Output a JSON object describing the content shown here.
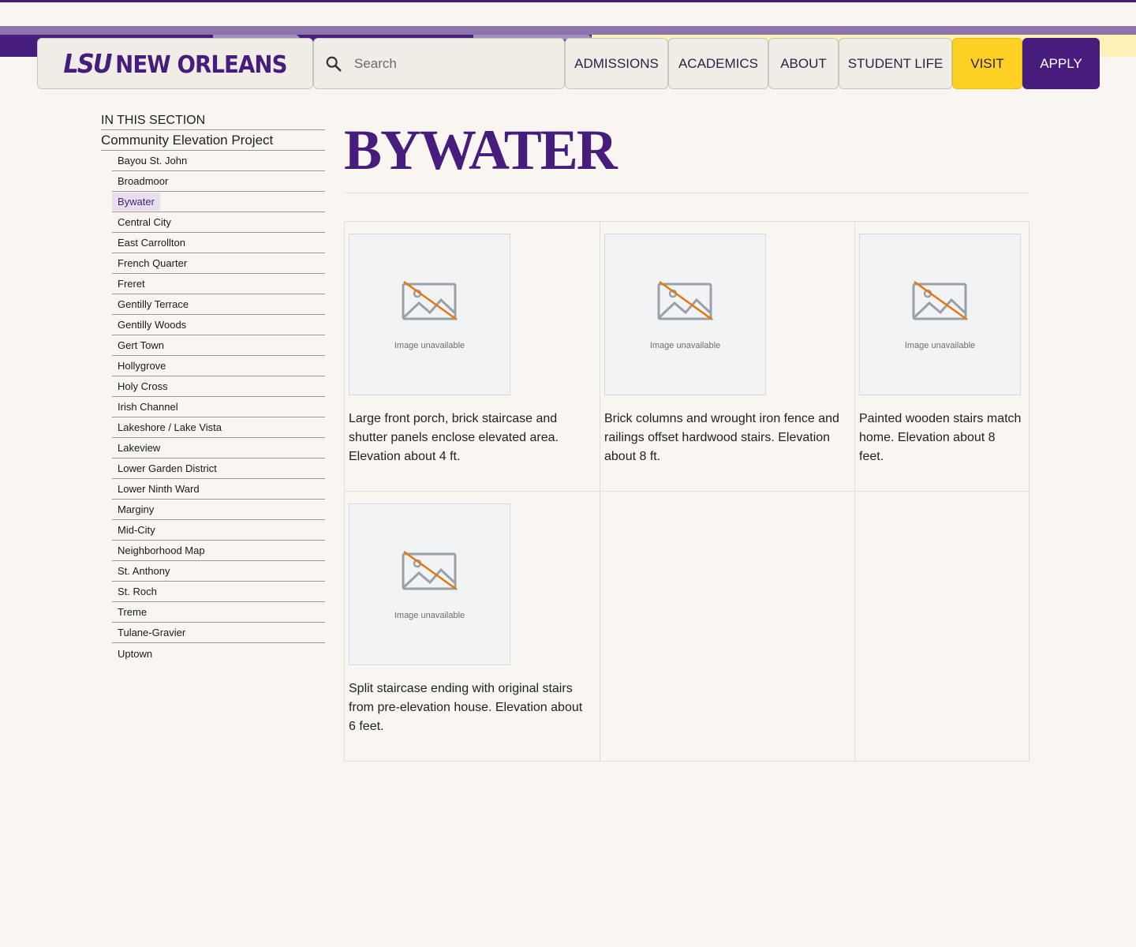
{
  "header": {
    "logo_text": "LSU NEW ORLEANS",
    "logo_part1": "LSU",
    "logo_part2": "NEW ORLEANS",
    "search_placeholder": "Search",
    "nav": {
      "admissions": "ADMISSIONS",
      "academics": "ACADEMICS",
      "about": "ABOUT",
      "student_life": "STUDENT LIFE",
      "visit": "VISIT",
      "apply": "APPLY"
    }
  },
  "sidebar": {
    "heading": "IN THIS SECTION",
    "parent": "Community Elevation Project",
    "items": [
      "Bayou St. John",
      "Broadmoor",
      "Bywater",
      "Central City",
      "East Carrollton",
      "French Quarter",
      "Freret",
      "Gentilly Terrace",
      "Gentilly Woods",
      "Gert Town",
      "Hollygrove",
      "Holy Cross",
      "Irish Channel",
      "Lakeshore / Lake Vista",
      "Lakeview",
      "Lower Garden District",
      "Lower Ninth Ward",
      "Marginy",
      "Mid-City",
      "Neighborhood Map",
      "St. Anthony",
      "St. Roch",
      "Treme",
      "Tulane-Gravier",
      "Uptown"
    ],
    "active": "Bywater"
  },
  "main": {
    "title": "BYWATER",
    "image_unavailable": "Image unavailable",
    "gallery": [
      "Large front porch, brick staircase and shutter panels enclose elevated area. Elevation about 4 ft.",
      "Brick columns and wrought iron fence and railings offset hardwood stairs. Elevation about 8 ft.",
      "Painted wooden stairs match home. Elevation about 8 feet.",
      "Split staircase ending with original stairs from pre-elevation house. Elevation about 6 feet."
    ]
  },
  "colors": {
    "brand_purple": "#461d7c",
    "brand_gold": "#fdd023",
    "background": "#f9f6f1"
  }
}
